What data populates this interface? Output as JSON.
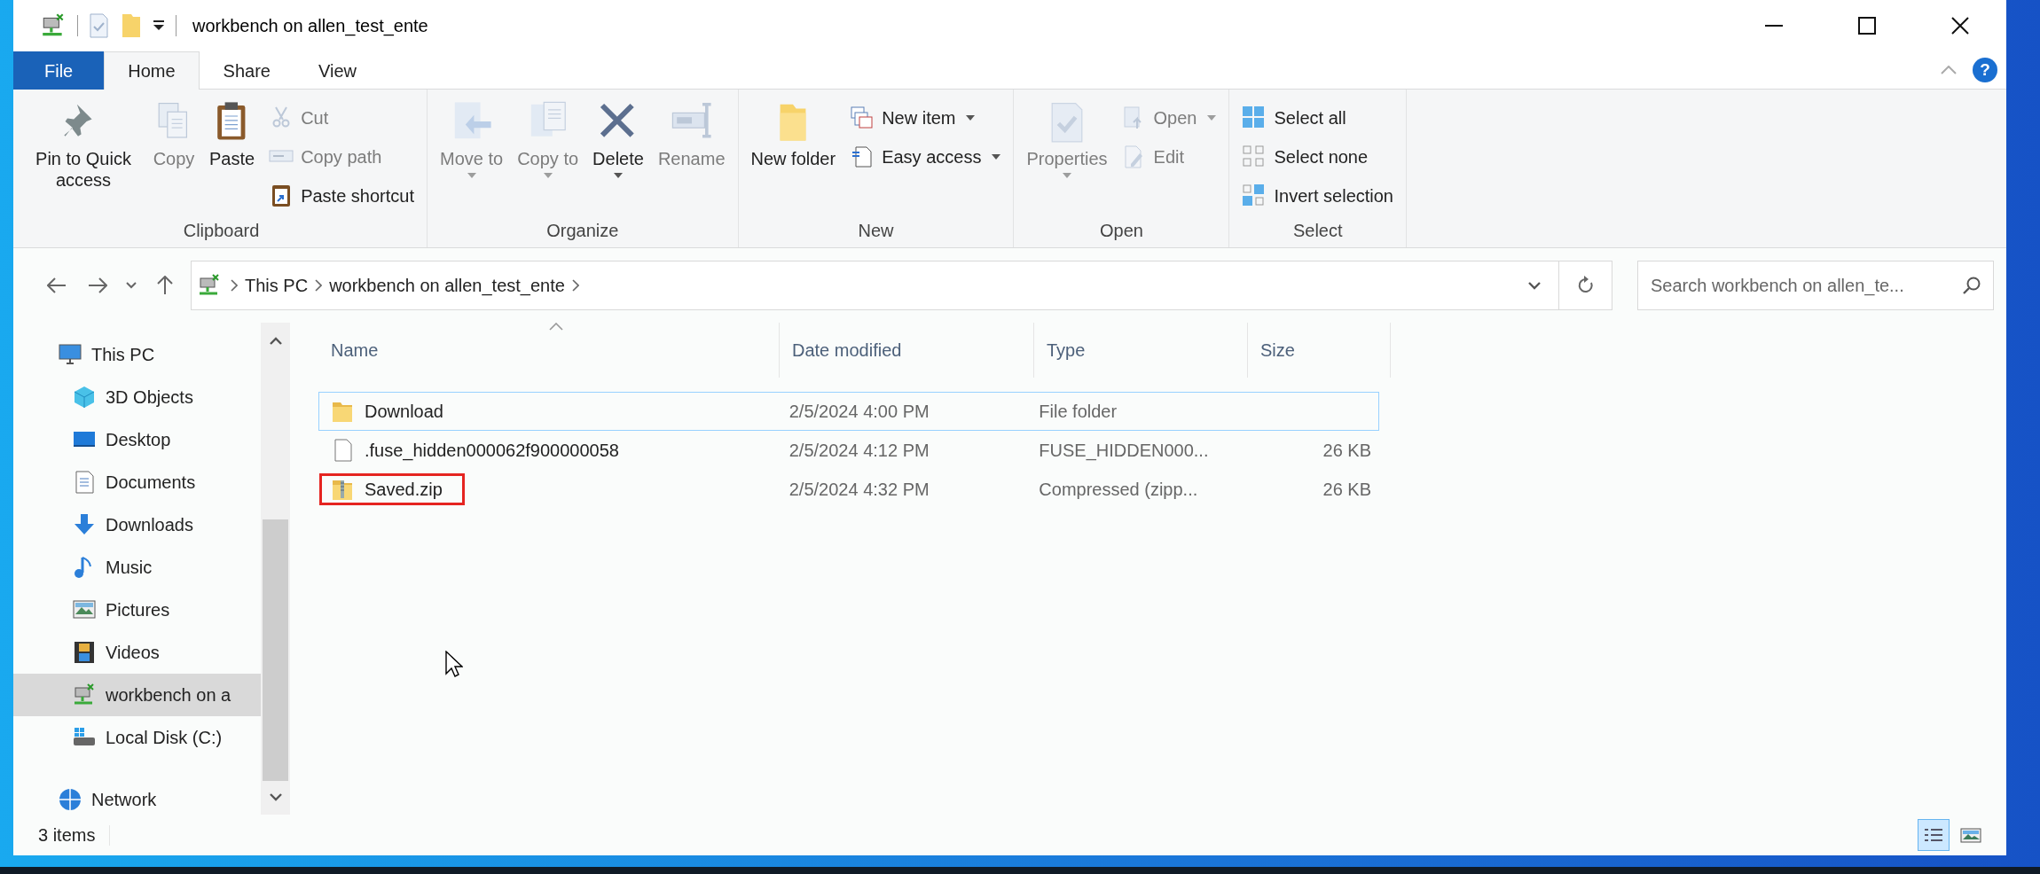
{
  "window": {
    "title": "workbench on allen_test_ente"
  },
  "ribbon_tabs": [
    {
      "label": "File",
      "kind": "file",
      "selected": false
    },
    {
      "label": "Home",
      "kind": "tab",
      "selected": true
    },
    {
      "label": "Share",
      "kind": "tab",
      "selected": false
    },
    {
      "label": "View",
      "kind": "tab",
      "selected": false
    }
  ],
  "help": {
    "label": "?"
  },
  "ribbon_groups": [
    {
      "label": "Clipboard",
      "items": [
        {
          "kind": "large",
          "label": "Pin to Quick access",
          "disabled": false,
          "has_menu": false
        },
        {
          "kind": "large",
          "label": "Copy",
          "disabled": true,
          "has_menu": false
        },
        {
          "kind": "large",
          "label": "Paste",
          "disabled": false,
          "has_menu": false
        },
        {
          "kind": "small",
          "label": "Cut",
          "disabled": true,
          "has_menu": false
        },
        {
          "kind": "small",
          "label": "Copy path",
          "disabled": true,
          "has_menu": false
        },
        {
          "kind": "small",
          "label": "Paste shortcut",
          "disabled": false,
          "has_menu": false
        }
      ]
    },
    {
      "label": "Organize",
      "items": [
        {
          "kind": "large",
          "label": "Move to",
          "disabled": true,
          "has_menu": true
        },
        {
          "kind": "large",
          "label": "Copy to",
          "disabled": true,
          "has_menu": true
        },
        {
          "kind": "large",
          "label": "Delete",
          "disabled": false,
          "has_menu": true
        },
        {
          "kind": "large",
          "label": "Rename",
          "disabled": true,
          "has_menu": false
        }
      ]
    },
    {
      "label": "New",
      "items": [
        {
          "kind": "large",
          "label": "New folder",
          "disabled": false,
          "has_menu": false
        },
        {
          "kind": "small",
          "label": "New item",
          "disabled": false,
          "has_menu": true
        },
        {
          "kind": "small",
          "label": "Easy access",
          "disabled": false,
          "has_menu": true
        }
      ]
    },
    {
      "label": "Open",
      "items": [
        {
          "kind": "large",
          "label": "Properties",
          "disabled": true,
          "has_menu": true
        },
        {
          "kind": "small",
          "label": "Open",
          "disabled": true,
          "has_menu": true
        },
        {
          "kind": "small",
          "label": "Edit",
          "disabled": true,
          "has_menu": false
        }
      ]
    },
    {
      "label": "Select",
      "items": [
        {
          "kind": "small",
          "label": "Select all",
          "disabled": false,
          "has_menu": false
        },
        {
          "kind": "small",
          "label": "Select none",
          "disabled": false,
          "has_menu": false
        },
        {
          "kind": "small",
          "label": "Invert selection",
          "disabled": false,
          "has_menu": false
        }
      ]
    }
  ],
  "address_bar": {
    "breadcrumbs": [
      "This PC",
      "workbench on allen_test_ente"
    ]
  },
  "search": {
    "placeholder": "Search workbench on allen_te..."
  },
  "nav_pane": [
    {
      "label": "This PC",
      "selected": false,
      "children": [
        {
          "label": "3D Objects",
          "selected": false
        },
        {
          "label": "Desktop",
          "selected": false
        },
        {
          "label": "Documents",
          "selected": false
        },
        {
          "label": "Downloads",
          "selected": false
        },
        {
          "label": "Music",
          "selected": false
        },
        {
          "label": "Pictures",
          "selected": false
        },
        {
          "label": "Videos",
          "selected": false
        },
        {
          "label": "workbench on a",
          "selected": true
        },
        {
          "label": "Local Disk (C:)",
          "selected": false
        }
      ]
    },
    {
      "label": "Network",
      "selected": false
    }
  ],
  "file_list": {
    "columns": [
      {
        "label": "Name",
        "sorted": true
      },
      {
        "label": "Date modified",
        "sorted": false
      },
      {
        "label": "Type",
        "sorted": false
      },
      {
        "label": "Size",
        "sorted": false
      }
    ],
    "rows": [
      {
        "name": "Download",
        "kind": "folder",
        "date_modified": "2/5/2024 4:00 PM",
        "type": "File folder",
        "size": "",
        "focused": true,
        "highlighted": false
      },
      {
        "name": ".fuse_hidden000062f900000058",
        "kind": "file",
        "date_modified": "2/5/2024 4:12 PM",
        "type": "FUSE_HIDDEN000...",
        "size": "26 KB",
        "focused": false,
        "highlighted": false
      },
      {
        "name": "Saved.zip",
        "kind": "zip",
        "date_modified": "2/5/2024 4:32 PM",
        "type": "Compressed (zipp...",
        "size": "26 KB",
        "focused": false,
        "highlighted": true
      }
    ]
  },
  "status_bar": {
    "item_count": "3 items"
  },
  "view_buttons": [
    {
      "kind": "details",
      "selected": true
    },
    {
      "kind": "large-icons",
      "selected": false
    }
  ]
}
